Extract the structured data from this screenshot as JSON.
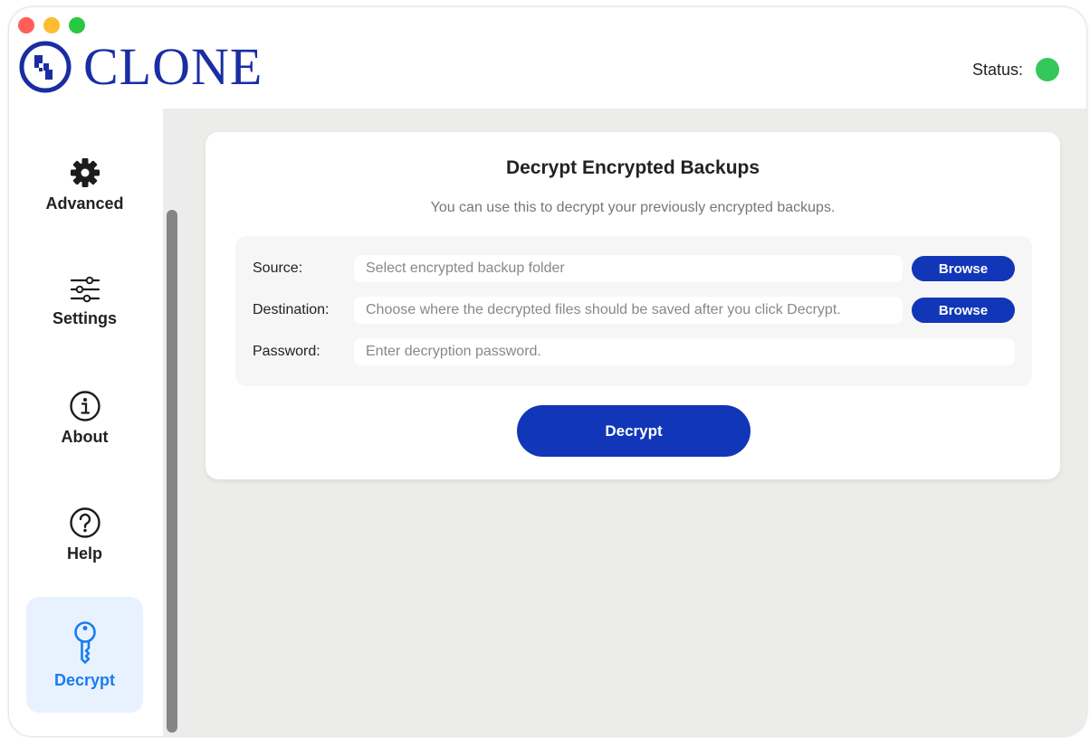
{
  "app": {
    "logo_text": "CLONE",
    "status_label": "Status:",
    "status_color": "#34c759",
    "brand_color": "#1a2da3",
    "accent_color": "#1236b8"
  },
  "sidebar": {
    "items": [
      {
        "label": "Advanced",
        "icon": "gear-icon",
        "active": false
      },
      {
        "label": "Settings",
        "icon": "sliders-icon",
        "active": false
      },
      {
        "label": "About",
        "icon": "info-icon",
        "active": false
      },
      {
        "label": "Help",
        "icon": "question-icon",
        "active": false
      },
      {
        "label": "Decrypt",
        "icon": "key-icon",
        "active": true
      }
    ]
  },
  "decrypt_panel": {
    "title": "Decrypt Encrypted Backups",
    "subtitle": "You can use this to decrypt your previously encrypted backups.",
    "source": {
      "label": "Source:",
      "value": "",
      "placeholder": "Select encrypted backup folder",
      "button": "Browse"
    },
    "destination": {
      "label": "Destination:",
      "value": "",
      "placeholder": "Choose where the decrypted files should be saved after you click Decrypt.",
      "button": "Browse"
    },
    "password": {
      "label": "Password:",
      "value": "",
      "placeholder": "Enter decryption password."
    },
    "submit_label": "Decrypt"
  }
}
